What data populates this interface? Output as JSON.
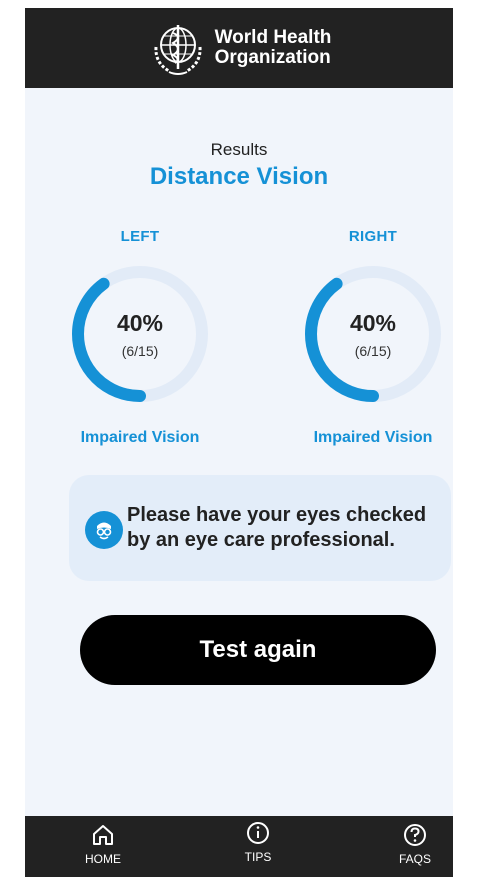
{
  "header": {
    "org_line1": "World Health",
    "org_line2": "Organization",
    "logo_icon": "who-emblem-icon"
  },
  "results": {
    "label": "Results",
    "title": "Distance Vision"
  },
  "eyes": [
    {
      "side": "LEFT",
      "percent": "40%",
      "fraction": "(6/15)",
      "level": 0.4,
      "status": "Impaired Vision"
    },
    {
      "side": "RIGHT",
      "percent": "40%",
      "fraction": "(6/15)",
      "level": 0.4,
      "status": "Impaired Vision"
    }
  ],
  "advice": {
    "icon": "eye-doctor-icon",
    "text": "Please have your eyes checked by an eye care professional."
  },
  "actions": {
    "test_again": "Test again"
  },
  "nav": [
    {
      "label": "HOME",
      "icon": "home-icon"
    },
    {
      "label": "TIPS",
      "icon": "info-icon"
    },
    {
      "label": "FAQS",
      "icon": "question-icon"
    }
  ],
  "colors": {
    "accent": "#1591d6",
    "track": "#e2ebf7",
    "bar": "#222222",
    "background": "#f1f5fb"
  }
}
